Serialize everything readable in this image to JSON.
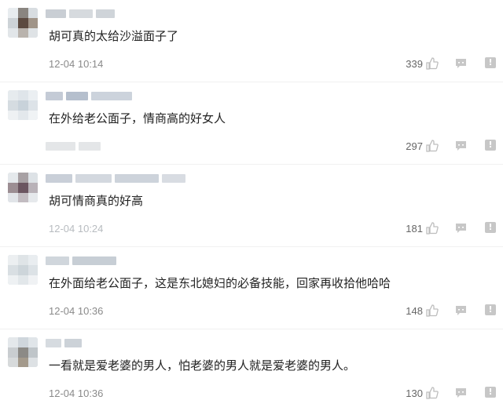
{
  "comments": [
    {
      "text": "胡可真的太给沙溢面子了",
      "time": "12-04 10:14",
      "likes": "339"
    },
    {
      "text": "在外给老公面子，情商高的好女人",
      "time": "",
      "likes": "297"
    },
    {
      "text": "胡可情商真的好高",
      "time": "12-04 10:24",
      "likes": "181"
    },
    {
      "text": "在外面给老公面子，这是东北媳妇的必备技能，回家再收拾他哈哈",
      "time": "12-04 10:36",
      "likes": "148"
    },
    {
      "text": "一看就是爱老婆的男人，怕老婆的男人就是爱老婆的男人。",
      "time": "12-04 10:36",
      "likes": "130"
    }
  ],
  "icons": {
    "like": "thumb-up-icon",
    "reply": "reply-icon",
    "report": "report-icon"
  },
  "colors": {
    "text": "#222222",
    "meta": "#8a8a8a",
    "icon": "#c7c7c7"
  }
}
